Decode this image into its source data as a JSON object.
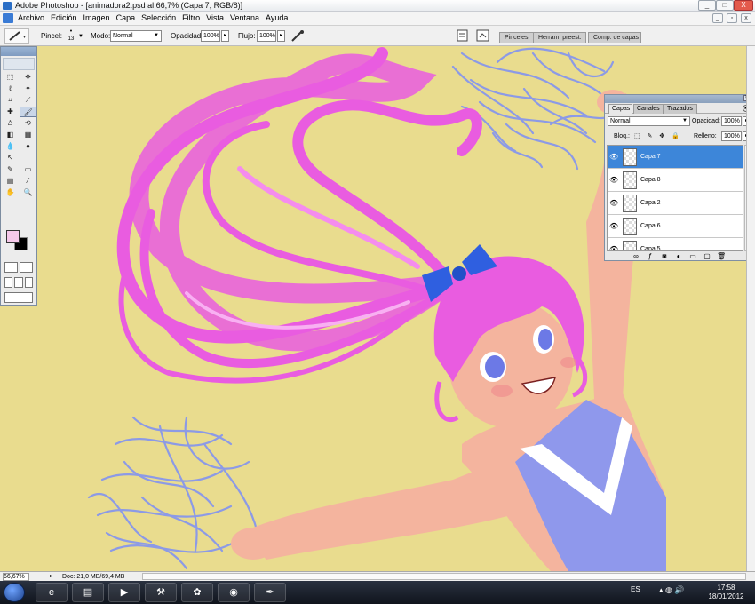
{
  "window": {
    "title": "Adobe Photoshop - [animadora2.psd al 66,7% (Capa 7, RGB/8)]",
    "controls": {
      "minimize": "_",
      "maximize": "□",
      "close": "X"
    },
    "doc_controls": {
      "minimize": "_",
      "restore": "▫",
      "close": "x"
    }
  },
  "menu": {
    "items": [
      "Archivo",
      "Edición",
      "Imagen",
      "Capa",
      "Selección",
      "Filtro",
      "Vista",
      "Ventana",
      "Ayuda"
    ]
  },
  "options_bar": {
    "brush_label": "Pincel:",
    "brush_size": "13",
    "mode_label": "Modo:",
    "mode_value": "Normal",
    "opacity_label": "Opacidad:",
    "opacity_value": "100%",
    "flow_label": "Flujo:",
    "flow_value": "100%"
  },
  "dock_tabs": [
    "Pinceles",
    "Herram. preest.",
    "Comp. de capas"
  ],
  "toolbox": {
    "foreground_color": "#f6c9ea",
    "background_color": "#000000",
    "tools": [
      "marquee-icon",
      "move-icon",
      "lasso-icon",
      "magic-wand-icon",
      "crop-icon",
      "slice-icon",
      "healing-icon",
      "brush-icon",
      "stamp-icon",
      "history-brush-icon",
      "eraser-icon",
      "gradient-icon",
      "blur-icon",
      "dodge-icon",
      "path-select-icon",
      "type-icon",
      "pen-icon",
      "shape-icon",
      "notes-icon",
      "eyedropper-icon",
      "hand-icon",
      "zoom-icon"
    ],
    "tool_glyphs": [
      "⬚",
      "✥",
      "ℓ",
      "✦",
      "⌗",
      "⟋",
      "✚",
      "🖌",
      "♙",
      "⟲",
      "◧",
      "▦",
      "💧",
      "●",
      "↖",
      "T",
      "✎",
      "▭",
      "▤",
      "⁄",
      "✋",
      "🔍"
    ],
    "selected_tool": "brush-icon"
  },
  "layers_panel": {
    "tabs": [
      "Capas",
      "Canales",
      "Trazados"
    ],
    "active_tab": "Capas",
    "blend_mode": "Normal",
    "opacity_label": "Opacidad:",
    "opacity_value": "100%",
    "lock_label": "Bloq.:",
    "fill_label": "Relleno:",
    "fill_value": "100%",
    "layers": [
      {
        "name": "Capa 7",
        "visible": true,
        "active": true
      },
      {
        "name": "Capa 8",
        "visible": true,
        "active": false
      },
      {
        "name": "Capa 2",
        "visible": true,
        "active": false
      },
      {
        "name": "Capa 6",
        "visible": true,
        "active": false
      },
      {
        "name": "Capa 5",
        "visible": true,
        "active": false
      }
    ],
    "footer_icons": [
      "link-icon",
      "layer-style-icon",
      "mask-icon",
      "adjustment-icon",
      "group-icon",
      "new-layer-icon",
      "trash-icon"
    ],
    "footer_glyphs": [
      "∞",
      "ƒ",
      "◙",
      "◐",
      "▭",
      "▢",
      "🗑"
    ]
  },
  "status_bar": {
    "zoom": "66,67%",
    "doc_info": "Doc: 21,0 MB/69,4 MB"
  },
  "taskbar": {
    "apps": [
      "ie-icon",
      "explorer-icon",
      "media-player-icon",
      "tool-icon",
      "messenger-icon",
      "chrome-icon",
      "photoshop-icon"
    ],
    "app_glyphs": [
      "e",
      "▤",
      "▶",
      "⚒",
      "✿",
      "◉",
      "✒"
    ],
    "language": "ES",
    "time": "17:58",
    "date": "18/01/2012"
  },
  "colors": {
    "canvas_bg": "#e9dc8e",
    "hair": "#e95ce0",
    "pompom": "#8c9ae6",
    "skin": "#f4b49e",
    "uniform": "#8f98ec",
    "layer_selected": "#3d86d9"
  }
}
